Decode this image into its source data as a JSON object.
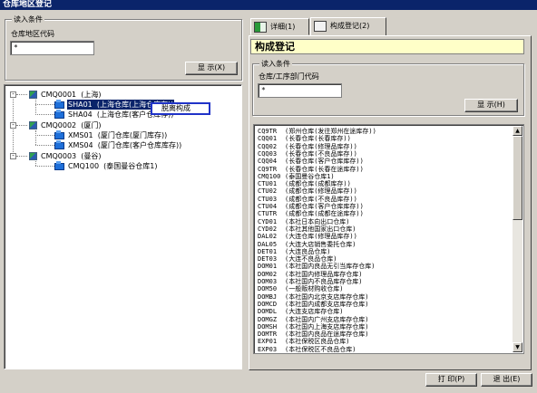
{
  "window": {
    "title": "仓库地区登记"
  },
  "left": {
    "group_title": "读入条件",
    "field_label": "仓库地区代码",
    "field_value": "*",
    "display_button": "显 示(X)",
    "tree": [
      {
        "code": "CMQ0001",
        "name": "(上海)",
        "expander": "-",
        "children": [
          {
            "code": "SHA01",
            "name": "(上海仓库(上海仓库存))",
            "selected": true
          },
          {
            "code": "SHA04",
            "name": "(上海仓库(客户仓库存))"
          }
        ]
      },
      {
        "code": "CMQ0002",
        "name": "(厦门)",
        "expander": "-",
        "children": [
          {
            "code": "XMS01",
            "name": "(厦门仓库(厦门库存))"
          },
          {
            "code": "XMS04",
            "name": "(厦门仓库(客户仓库库存))"
          }
        ]
      },
      {
        "code": "CMQ0003",
        "name": "(曼谷)",
        "expander": "-",
        "children": [
          {
            "code": "CMQ100",
            "name": "(泰国曼谷仓库1)"
          }
        ]
      }
    ],
    "context_menu": {
      "item": "脱离构成"
    }
  },
  "tabs": [
    {
      "label": "详细(1)",
      "icon": "book-icon"
    },
    {
      "label": "构成登记(2)",
      "icon": "document-icon"
    }
  ],
  "right": {
    "page_title": "构成登记",
    "group_title": "读入条件",
    "field_label": "仓库/工序部门代码",
    "field_value": "*",
    "display_button": "显 示(H)",
    "list": [
      {
        "code": "CQ9TR",
        "name": "(郑州仓库(发往郑州在途库存))"
      },
      {
        "code": "CQQ01",
        "name": "(长春仓库(长春库存))"
      },
      {
        "code": "CQQ02",
        "name": "(长春仓库(修理品库存))"
      },
      {
        "code": "CQQ03",
        "name": "(长春仓库(不良品库存))"
      },
      {
        "code": "CQQ04",
        "name": "(长春仓库(客户仓库库存))"
      },
      {
        "code": "CQ9TR",
        "name": "(长春仓库(长春在途库存))"
      },
      {
        "code": "CMQ100",
        "name": "(泰国曼谷仓库1)"
      },
      {
        "code": "CTU01",
        "name": "(成都仓库(成都库存))"
      },
      {
        "code": "CTU02",
        "name": "(成都仓库(修理品库存))"
      },
      {
        "code": "CTU03",
        "name": "(成都仓库(不良品库存))"
      },
      {
        "code": "CTU04",
        "name": "(成都仓库(客户仓库库存))"
      },
      {
        "code": "CTUTR",
        "name": "(成都仓库(成都在途库存))"
      },
      {
        "code": "CYD01",
        "name": "(本社日本向出口仓库)"
      },
      {
        "code": "CYD02",
        "name": "(本社其他国家出口仓库)"
      },
      {
        "code": "DAL02",
        "name": "(大连仓库(修理品库存))"
      },
      {
        "code": "DAL05",
        "name": "(大连大店销售委托仓库)"
      },
      {
        "code": "DET01",
        "name": "(大连良品仓库)"
      },
      {
        "code": "DET03",
        "name": "(大连不良品仓库)"
      },
      {
        "code": "DOM01",
        "name": "(本社国内良品无引当库存仓库)"
      },
      {
        "code": "DOM02",
        "name": "(本社国内修理品库存仓库)"
      },
      {
        "code": "DOM03",
        "name": "(本社国内不良品库存仓库)"
      },
      {
        "code": "DOM50",
        "name": "(一般贩材购收仓库)"
      },
      {
        "code": "DOMBJ",
        "name": "(本社国内北京支店库存仓库)"
      },
      {
        "code": "DOMCD",
        "name": "(本社国内成都支店库存仓库)"
      },
      {
        "code": "DOMDL",
        "name": "(大连支店库存仓库)"
      },
      {
        "code": "DOMGZ",
        "name": "(本社国内广州支店库存仓库)"
      },
      {
        "code": "DOMSH",
        "name": "(本社国内上海支店库存仓库)"
      },
      {
        "code": "DOMTR",
        "name": "(本社国内良品在途库存仓库)"
      },
      {
        "code": "EXP01",
        "name": "(本社保税区良品仓库)"
      },
      {
        "code": "EXP03",
        "name": "(本社保税区不良品仓库)"
      }
    ]
  },
  "footer": {
    "print_button": "打 印(P)",
    "exit_button": "退 出(E)"
  }
}
